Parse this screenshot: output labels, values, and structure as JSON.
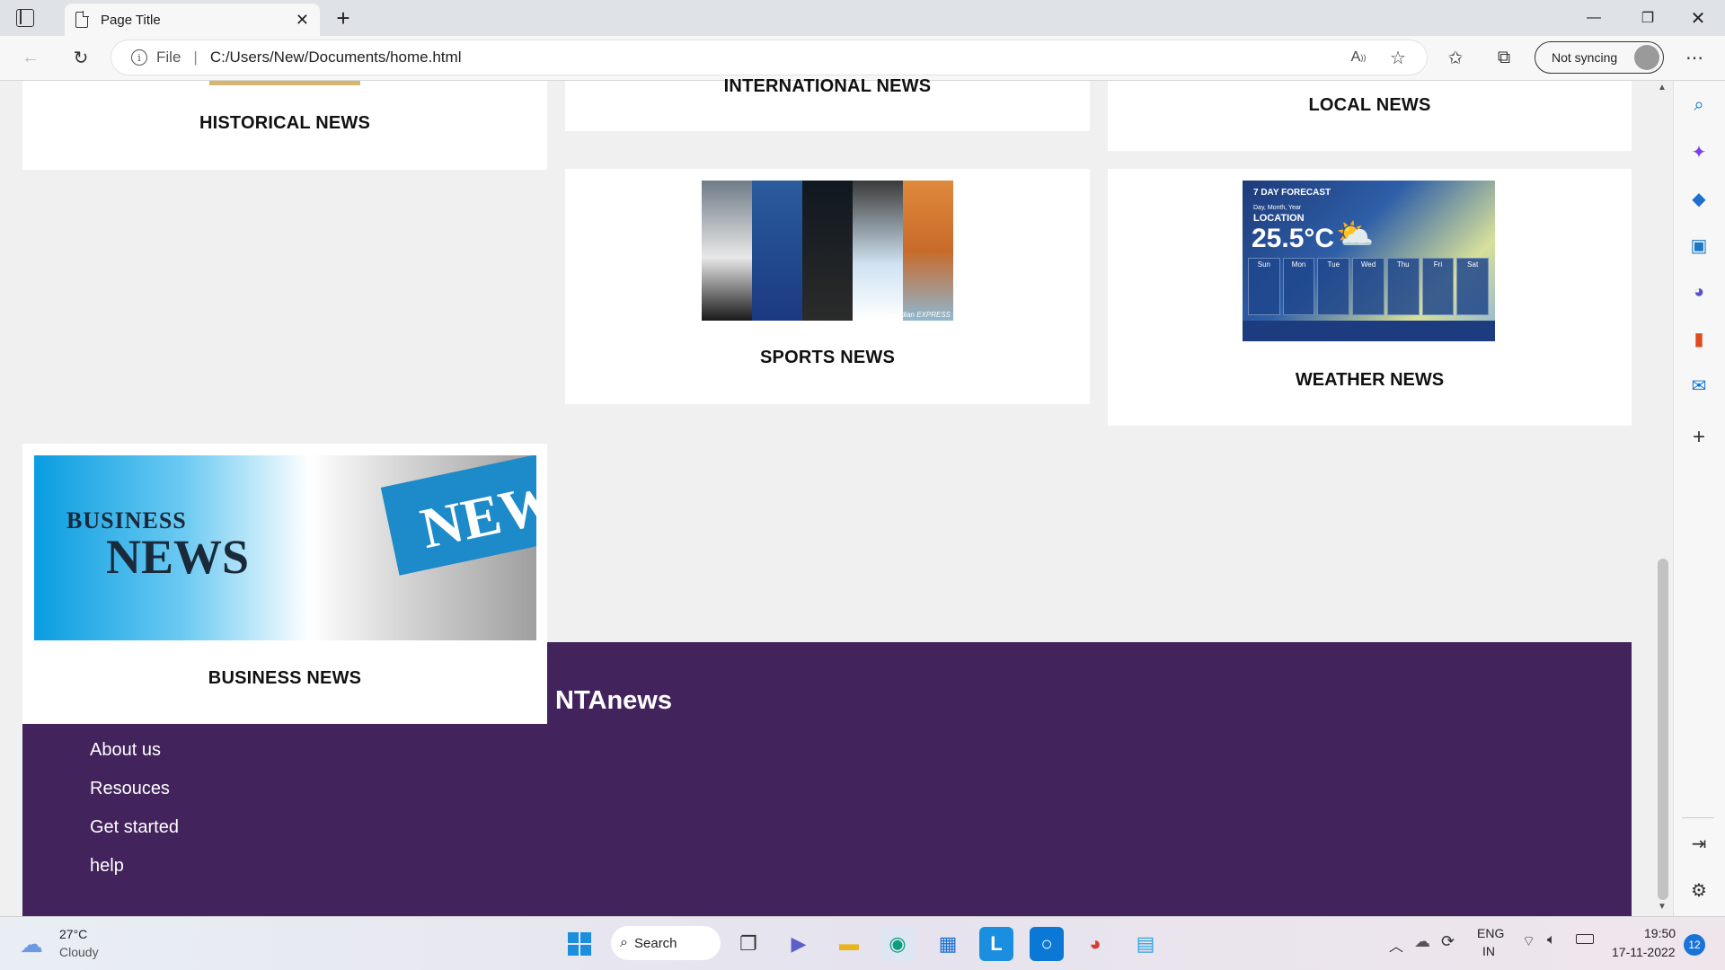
{
  "browser": {
    "tab_title": "Page Title",
    "address_prefix": "File",
    "url": "C:/Users/New/Documents/home.html",
    "profile_label": "Not syncing"
  },
  "cards": {
    "historical": "HISTORICAL NEWS",
    "international": "INTERNATIONAL NEWS",
    "local": "LOCAL NEWS",
    "sports": "SPORTS NEWS",
    "weather": "WEATHER NEWS",
    "business": "BUSINESS NEWS"
  },
  "weather_image": {
    "header": "7 DAY FORECAST",
    "date_label": "Day, Month, Year",
    "location": "LOCATION",
    "temperature": "25.5°C",
    "days": [
      "Sun",
      "Mon",
      "Tue",
      "Wed",
      "Thu",
      "Fri",
      "Sat"
    ]
  },
  "sports_image": {
    "credit": "The Indian EXPRESS"
  },
  "business_image": {
    "line1": "BUSINESS",
    "line2": "NEWS",
    "paper_text": "NEW"
  },
  "footer": {
    "brand": "NTAnews",
    "links": [
      "About us",
      "Resouces",
      "Get started",
      "help"
    ]
  },
  "taskbar": {
    "weather_temp": "27°C",
    "weather_desc": "Cloudy",
    "search_label": "Search",
    "lang1": "ENG",
    "lang2": "IN",
    "time": "19:50",
    "date": "17-11-2022",
    "notification_count": "12"
  },
  "colors": {
    "footer_purple": "#42235c",
    "page_bg": "#f0f0f0",
    "edge_blue": "#0a72d4"
  }
}
